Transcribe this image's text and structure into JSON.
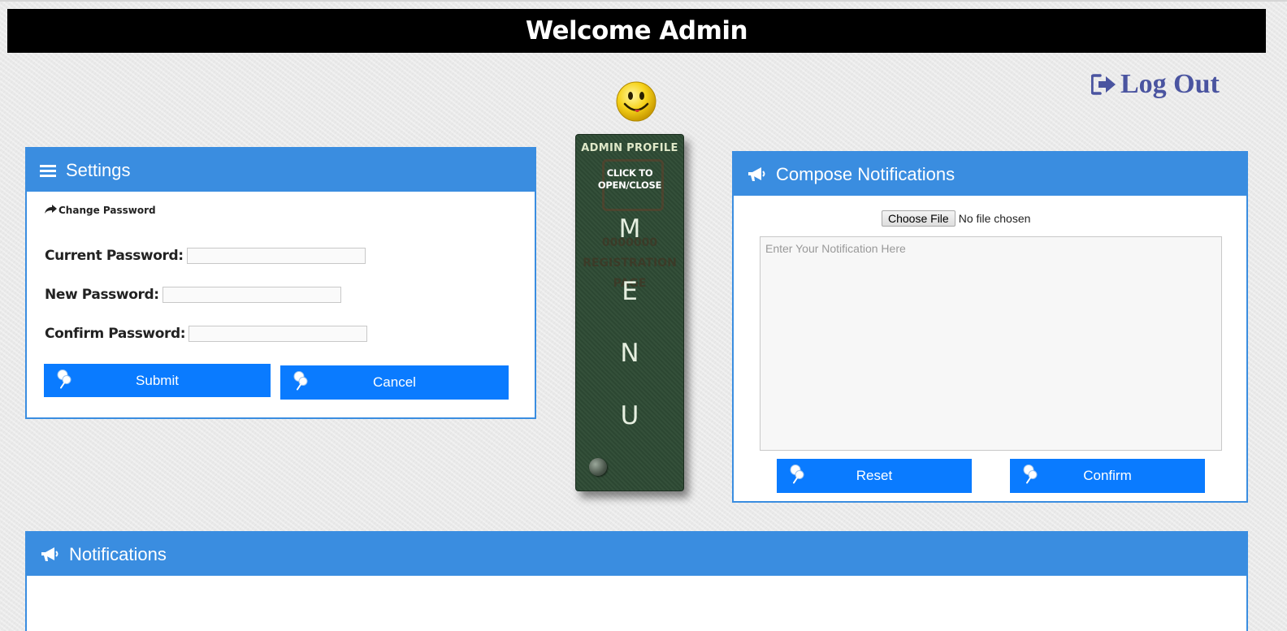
{
  "header": {
    "title": "Welcome Admin"
  },
  "logout": {
    "label": "Log Out",
    "icon": "sign-out-icon",
    "color": "#4a54a0"
  },
  "menu": {
    "title": "ADMIN PROFILE",
    "hint_line1": "CLICK TO",
    "hint_line2": "OPEN/CLOSE",
    "ghost_line1": "0000000",
    "ghost_line2": "REGISTRATION",
    "ghost_line3": "PAGE",
    "letters": [
      "M",
      "E",
      "N",
      "U"
    ]
  },
  "settings": {
    "title": "Settings",
    "icon": "menu-bars-icon",
    "link": "Change Password",
    "fields": [
      {
        "label": "Current Password:",
        "value": ""
      },
      {
        "label": "New Password:",
        "value": ""
      },
      {
        "label": "Confirm Password:",
        "value": ""
      }
    ],
    "submit": "Submit",
    "cancel": "Cancel"
  },
  "compose": {
    "title": "Compose Notifications",
    "icon": "megaphone-icon",
    "choose_file": "Choose File",
    "no_file": "No file chosen",
    "placeholder": "Enter Your Notification Here",
    "reset": "Reset",
    "confirm": "Confirm"
  },
  "notifications": {
    "title": "Notifications",
    "icon": "megaphone-icon"
  },
  "colors": {
    "panel_blue": "#3a8de0",
    "button_blue": "#0a7bff",
    "menu_green": "#2e4a34"
  }
}
